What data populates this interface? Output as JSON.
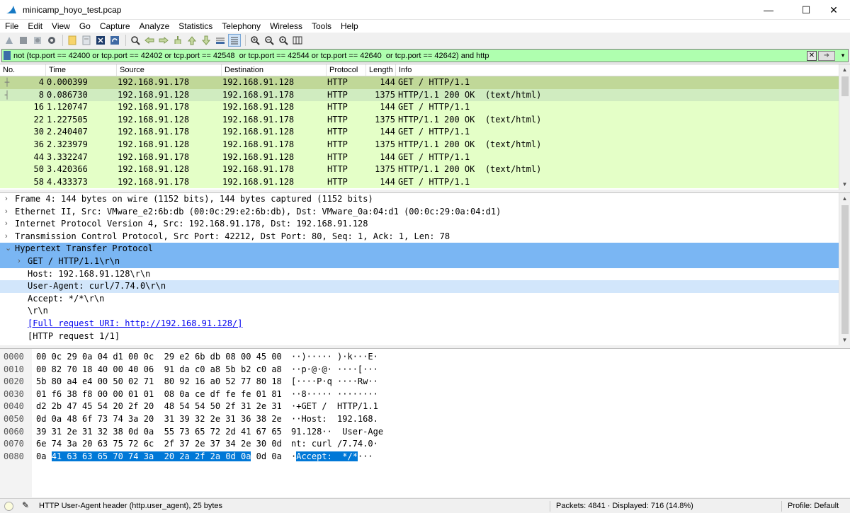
{
  "window": {
    "title": "minicamp_hoyo_test.pcap",
    "controls": {
      "minimize": "—",
      "maximize": "☐",
      "close": "✕"
    }
  },
  "menu": [
    "File",
    "Edit",
    "View",
    "Go",
    "Capture",
    "Analyze",
    "Statistics",
    "Telephony",
    "Wireless",
    "Tools",
    "Help"
  ],
  "toolbar": {
    "icons": [
      "start-capture-icon",
      "stop-capture-icon",
      "restart-capture-icon",
      "capture-options-icon",
      "open-file-icon",
      "save-file-icon",
      "close-file-icon",
      "reload-file-icon",
      "find-packet-icon",
      "go-back-icon",
      "go-forward-icon",
      "go-to-packet-icon",
      "go-first-icon",
      "go-last-icon",
      "auto-scroll-icon",
      "colorize-icon",
      "zoom-in-icon",
      "zoom-out-icon",
      "normal-size-icon",
      "resize-columns-icon"
    ]
  },
  "filter": {
    "value": "not (tcp.port == 42400 or tcp.port == 42402 or tcp.port == 42548  or tcp.port == 42544 or tcp.port == 42640  or tcp.port == 42642) and http",
    "background": "#afffaf"
  },
  "packet_list": {
    "columns": [
      "No.",
      "Time",
      "Source",
      "Destination",
      "Protocol",
      "Length",
      "Info"
    ],
    "rows": [
      {
        "no": "4",
        "time": "0.000399",
        "src": "192.168.91.178",
        "dst": "192.168.91.128",
        "proto": "HTTP",
        "len": "144",
        "info": "GET / HTTP/1.1"
      },
      {
        "no": "8",
        "time": "0.086730",
        "src": "192.168.91.128",
        "dst": "192.168.91.178",
        "proto": "HTTP",
        "len": "1375",
        "info": "HTTP/1.1 200 OK  (text/html)"
      },
      {
        "no": "16",
        "time": "1.120747",
        "src": "192.168.91.178",
        "dst": "192.168.91.128",
        "proto": "HTTP",
        "len": "144",
        "info": "GET / HTTP/1.1"
      },
      {
        "no": "22",
        "time": "1.227505",
        "src": "192.168.91.128",
        "dst": "192.168.91.178",
        "proto": "HTTP",
        "len": "1375",
        "info": "HTTP/1.1 200 OK  (text/html)"
      },
      {
        "no": "30",
        "time": "2.240407",
        "src": "192.168.91.178",
        "dst": "192.168.91.128",
        "proto": "HTTP",
        "len": "144",
        "info": "GET / HTTP/1.1"
      },
      {
        "no": "36",
        "time": "2.323979",
        "src": "192.168.91.128",
        "dst": "192.168.91.178",
        "proto": "HTTP",
        "len": "1375",
        "info": "HTTP/1.1 200 OK  (text/html)"
      },
      {
        "no": "44",
        "time": "3.332247",
        "src": "192.168.91.178",
        "dst": "192.168.91.128",
        "proto": "HTTP",
        "len": "144",
        "info": "GET / HTTP/1.1"
      },
      {
        "no": "50",
        "time": "3.420366",
        "src": "192.168.91.128",
        "dst": "192.168.91.178",
        "proto": "HTTP",
        "len": "1375",
        "info": "HTTP/1.1 200 OK  (text/html)"
      },
      {
        "no": "58",
        "time": "4.433373",
        "src": "192.168.91.178",
        "dst": "192.168.91.128",
        "proto": "HTTP",
        "len": "144",
        "info": "GET / HTTP/1.1"
      }
    ],
    "row_color": "#e4ffc7",
    "selected_color": "#c0d898"
  },
  "details": [
    {
      "text": "Frame 4: 144 bytes on wire (1152 bits), 144 bytes captured (1152 bits)",
      "indent": 0,
      "arrow": "›"
    },
    {
      "text": "Ethernet II, Src: VMware_e2:6b:db (00:0c:29:e2:6b:db), Dst: VMware_0a:04:d1 (00:0c:29:0a:04:d1)",
      "indent": 0,
      "arrow": "›"
    },
    {
      "text": "Internet Protocol Version 4, Src: 192.168.91.178, Dst: 192.168.91.128",
      "indent": 0,
      "arrow": "›"
    },
    {
      "text": "Transmission Control Protocol, Src Port: 42212, Dst Port: 80, Seq: 1, Ack: 1, Len: 78",
      "indent": 0,
      "arrow": "›"
    },
    {
      "text": "Hypertext Transfer Protocol",
      "indent": 0,
      "arrow": "⌄"
    },
    {
      "text": "GET / HTTP/1.1\\r\\n",
      "indent": 1,
      "arrow": "›"
    },
    {
      "text": "Host: 192.168.91.128\\r\\n",
      "indent": 1,
      "arrow": ""
    },
    {
      "text": "User-Agent: curl/7.74.0\\r\\n",
      "indent": 1,
      "arrow": ""
    },
    {
      "text": "Accept: */*\\r\\n",
      "indent": 1,
      "arrow": ""
    },
    {
      "text": "\\r\\n",
      "indent": 1,
      "arrow": ""
    },
    {
      "text": "[Full request URI: http://192.168.91.128/]",
      "indent": 1,
      "arrow": ""
    },
    {
      "text": "[HTTP request 1/1]",
      "indent": 1,
      "arrow": ""
    }
  ],
  "bytes": [
    {
      "off": "0000",
      "hex": "00 0c 29 0a 04 d1 00 0c  29 e2 6b db 08 00 45 00",
      "asc": "··)····· )·k···E·"
    },
    {
      "off": "0010",
      "hex": "00 82 70 18 40 00 40 06  91 da c0 a8 5b b2 c0 a8",
      "asc": "··p·@·@· ····[···"
    },
    {
      "off": "0020",
      "hex": "5b 80 a4 e4 00 50 02 71  80 92 16 a0 52 77 80 18",
      "asc": "[····P·q ····Rw··"
    },
    {
      "off": "0030",
      "hex": "01 f6 38 f8 00 00 01 01  08 0a ce df fe fe 01 81",
      "asc": "··8····· ········"
    },
    {
      "off": "0040",
      "hex": "d2 2b 47 45 54 20 2f 20  48 54 54 50 2f 31 2e 31",
      "asc": "·+GET /  HTTP/1.1"
    },
    {
      "off": "0050",
      "hex": "0d 0a 48 6f 73 74 3a 20  31 39 32 2e 31 36 38 2e",
      "asc": "··Host:  192.168."
    },
    {
      "off": "0060",
      "hex": "39 31 2e 31 32 38 0d 0a  55 73 65 72 2d 41 67 65",
      "asc": "91.128··  User-Age"
    },
    {
      "off": "0070",
      "hex": "6e 74 3a 20 63 75 72 6c  2f 37 2e 37 34 2e 30 0d",
      "asc": "nt: curl /7.74.0·"
    },
    {
      "off": "0080",
      "hex_pre": "0a ",
      "hex_sel": "41 63 63 65 70 74 3a  20 2a 2f 2a 0d 0a",
      "hex_post": " 0d 0a",
      "asc_pre": "·",
      "asc_sel": "Accept:  */*",
      "asc_post": "···"
    }
  ],
  "status": {
    "text": "HTTP User-Agent header (http.user_agent), 25 bytes",
    "packets": "Packets: 4841 · Displayed: 716 (14.8%)",
    "profile": "Profile: Default"
  }
}
